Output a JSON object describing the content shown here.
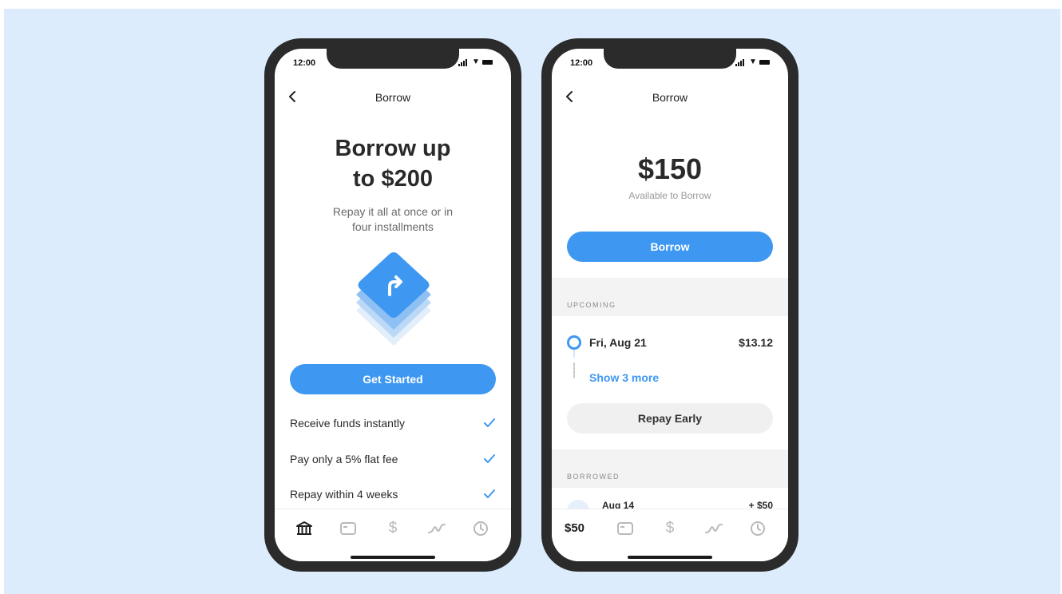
{
  "colors": {
    "background": "#dcecfc",
    "accent": "#3e98f2",
    "phone_frame": "#2b2b2b"
  },
  "left_phone": {
    "status": {
      "time": "12:00"
    },
    "nav": {
      "title": "Borrow",
      "back_icon": "chevron-left-icon"
    },
    "hero": {
      "title_line1": "Borrow up",
      "title_line2": "to $200",
      "subtitle_line1": "Repay it all at once or in",
      "subtitle_line2": "four installments",
      "icon": "borrow-arrow-icon"
    },
    "cta_label": "Get Started",
    "features": [
      {
        "label": "Receive funds instantly",
        "icon": "check-icon"
      },
      {
        "label": "Pay only a 5% flat fee",
        "icon": "check-icon"
      },
      {
        "label": "Repay within 4 weeks",
        "icon": "check-icon"
      }
    ],
    "tabs": [
      "bank-icon",
      "card-icon",
      "dollar-icon",
      "activity-icon",
      "clock-icon"
    ]
  },
  "right_phone": {
    "status": {
      "time": "12:00"
    },
    "nav": {
      "title": "Borrow",
      "back_icon": "chevron-left-icon"
    },
    "amount": "$150",
    "amount_caption": "Available to Borrow",
    "borrow_label": "Borrow",
    "upcoming_header": "UPCOMING",
    "upcoming_row": {
      "date": "Fri, Aug 21",
      "amount": "$13.12"
    },
    "show_more": "Show 3 more",
    "repay_label": "Repay Early",
    "borrowed_header": "BORROWED",
    "borrowed_row": {
      "date": "Aug 14",
      "amount": "+ $50"
    },
    "tab_balance": "$50",
    "tabs": [
      "card-icon",
      "dollar-icon",
      "activity-icon",
      "clock-icon"
    ]
  }
}
